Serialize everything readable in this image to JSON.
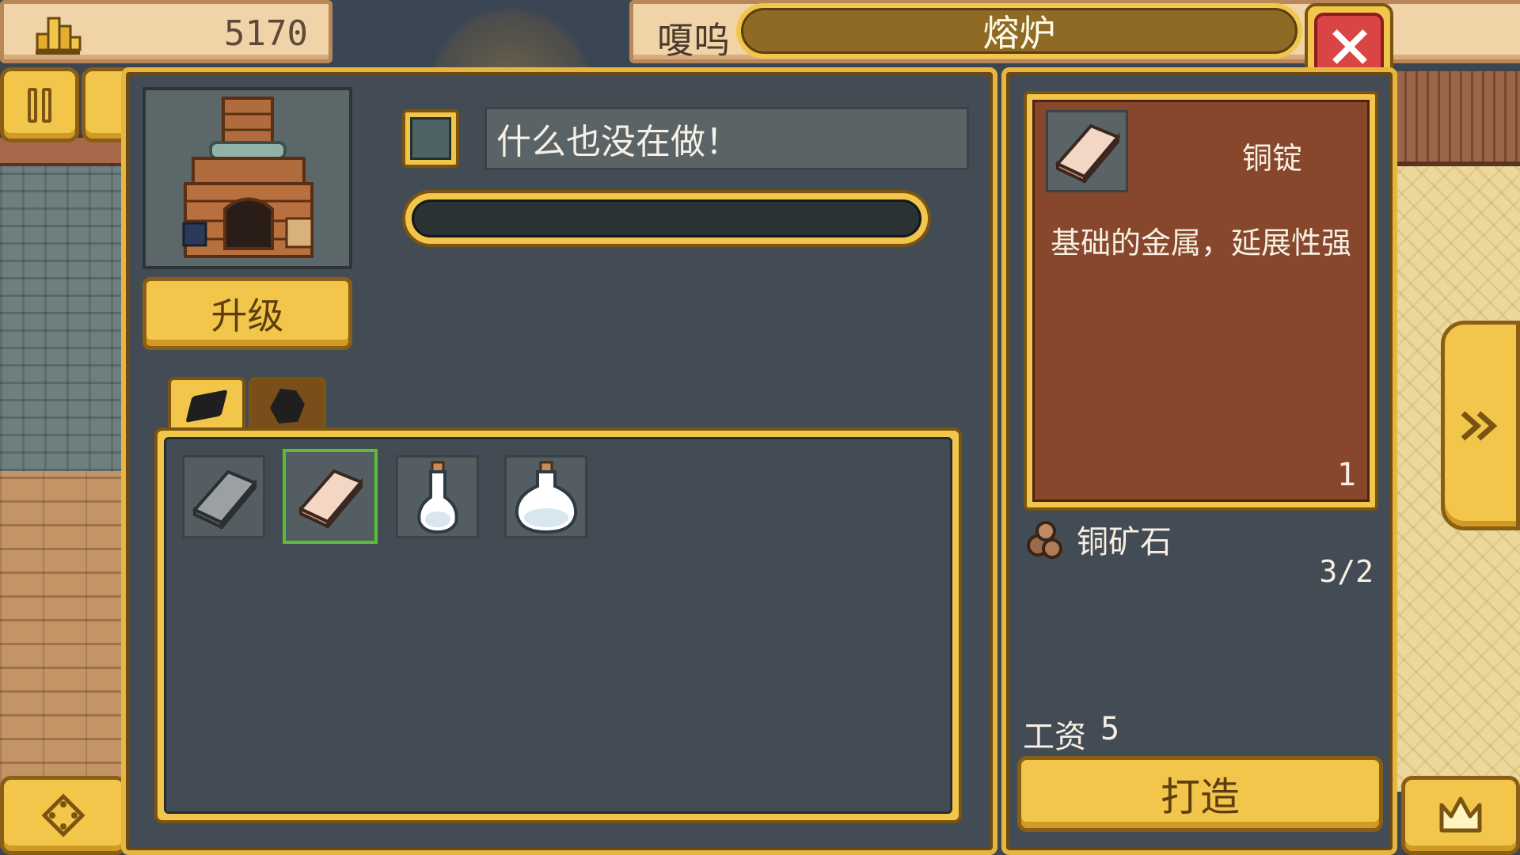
{
  "hud": {
    "money_value": "5170",
    "character_name": "嗄呜"
  },
  "window": {
    "title": "熔炉",
    "close_icon": "close-icon"
  },
  "furnace": {
    "upgrade_label": "升级",
    "status_text": "什么也没在做！",
    "progress": 0
  },
  "tabs": [
    {
      "icon": "ingot-icon",
      "active": true
    },
    {
      "icon": "ore-icon",
      "active": false
    }
  ],
  "inventory": [
    {
      "icon": "iron-ingot-icon"
    },
    {
      "icon": "copper-ingot-icon",
      "selected": true
    },
    {
      "icon": "small-vial-icon"
    },
    {
      "icon": "round-flask-icon"
    }
  ],
  "detail": {
    "name": "铜锭",
    "description": "基础的金属，延展性强",
    "quantity": "1",
    "requirement": {
      "name": "铜矿石",
      "count": "3/2"
    },
    "wage_label": "工资",
    "wage_value": "5",
    "craft_label": "打造"
  },
  "colors": {
    "gold": "#f2c64a",
    "panel": "#434b55",
    "detail_bg": "#86472c",
    "close": "#d94444",
    "selected": "#59c036"
  }
}
